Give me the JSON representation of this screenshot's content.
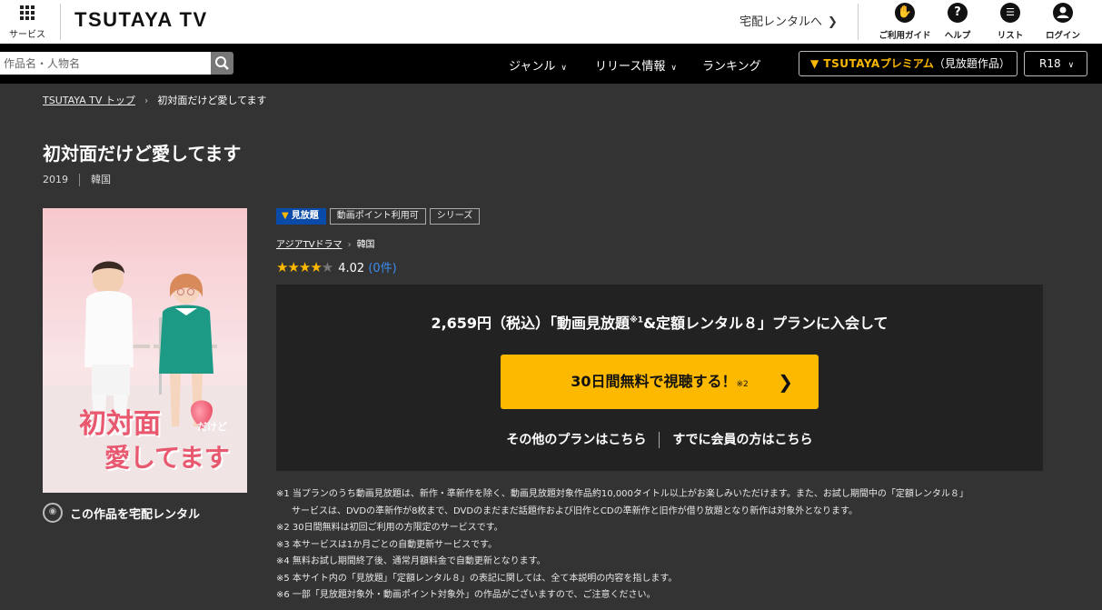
{
  "header": {
    "services_label": "サービス",
    "logo": "TSUTAYA TV",
    "delivery_link": "宅配レンタルへ",
    "icons": [
      {
        "label": "ご利用ガイド",
        "icon": "guide-icon"
      },
      {
        "label": "ヘルプ",
        "icon": "help-icon"
      },
      {
        "label": "リスト",
        "icon": "list-icon"
      },
      {
        "label": "ログイン",
        "icon": "user-icon"
      }
    ]
  },
  "nav": {
    "search_placeholder": "作品名・人物名",
    "genre": "ジャンル",
    "release": "リリース情報",
    "ranking": "ランキング",
    "premium_brand": "TSUTAYA",
    "premium_word": "プレミアム",
    "premium_suffix": "（見放題作品）",
    "r18": "R18"
  },
  "breadcrumb": {
    "home": "TSUTAYA TV トップ",
    "current": "初対面だけど愛してます"
  },
  "title": {
    "text": "初対面だけど愛してます",
    "year": "2019",
    "country": "韓国"
  },
  "poster": {
    "title_line1": "初対面",
    "title_small": "だけど",
    "title_line2": "愛してます"
  },
  "rental_link": "この作品を宅配レンタル",
  "tags": [
    "見放題",
    "動画ポイント利用可",
    "シリーズ"
  ],
  "genre": {
    "category": "アジアTVドラマ",
    "sub": "韓国"
  },
  "rating": {
    "value": "4.02",
    "count": "(0件)",
    "stars": 4
  },
  "plan": {
    "head_a": "2,659円（税込）「動画見放題",
    "head_note": "※1",
    "head_b": "&定額レンタル８」プランに入会して",
    "cta": "30日間無料で視聴する！",
    "cta_note": "※2",
    "other_plans": "その他のプランはこちら",
    "member": "すでに会員の方はこちら"
  },
  "notes": [
    "※1 当プランのうち動画見放題は、新作・準新作を除く、動画見放題対象作品約10,000タイトル以上がお楽しみいただけます。また、お試し期間中の「定額レンタル８」",
    "サービスは、DVDの準新作が8枚まで、DVDのまだまだ話題作および旧作とCDの準新作と旧作が借り放題となり新作は対象外となります。",
    "※2 30日間無料は初回ご利用の方限定のサービスです。",
    "※3 本サービスは1か月ごとの自動更新サービスです。",
    "※4 無料お試し期間終了後、通常月額料金で自動更新となります。",
    "※5 本サイト内の「見放題」「定額レンタル８」の表記に関しては、全て本説明の内容を指します。",
    "※6 一部「見放題対象外・動画ポイント対象外」の作品がございますので、ご注意ください。"
  ],
  "colors": {
    "background": "#333333",
    "accent": "#fcb900",
    "plan_bg": "#222222",
    "tag_blue": "#0a4aa8",
    "link_blue": "#3b8cf0"
  }
}
